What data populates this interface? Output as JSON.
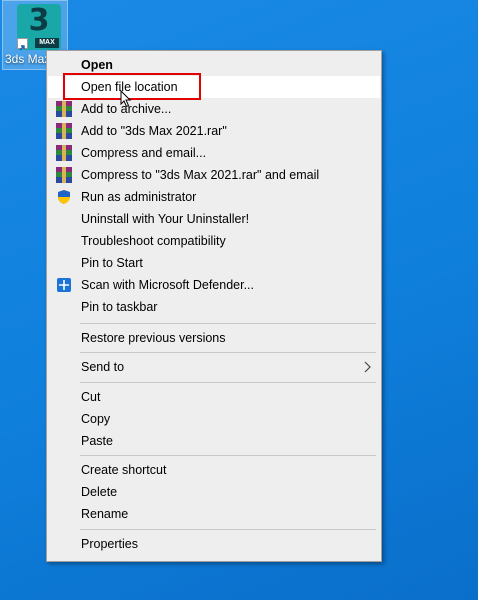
{
  "desktop": {
    "icon_label": "3ds Max",
    "logo_number": "3",
    "logo_text": "MAX"
  },
  "menu": {
    "items": [
      {
        "label": "Open"
      },
      {
        "label": "Open file location"
      },
      {
        "label": "Add to archive..."
      },
      {
        "label": "Add to \"3ds Max 2021.rar\""
      },
      {
        "label": "Compress and email..."
      },
      {
        "label": "Compress to \"3ds Max 2021.rar\" and email"
      },
      {
        "label": "Run as administrator"
      },
      {
        "label": "Uninstall with Your Uninstaller!"
      },
      {
        "label": "Troubleshoot compatibility"
      },
      {
        "label": "Pin to Start"
      },
      {
        "label": "Scan with Microsoft Defender..."
      },
      {
        "label": "Pin to taskbar"
      },
      {
        "label": "Restore previous versions"
      },
      {
        "label": "Send to"
      },
      {
        "label": "Cut"
      },
      {
        "label": "Copy"
      },
      {
        "label": "Paste"
      },
      {
        "label": "Create shortcut"
      },
      {
        "label": "Delete"
      },
      {
        "label": "Rename"
      },
      {
        "label": "Properties"
      }
    ],
    "submenu_icon": "chevron-right-icon"
  },
  "colors": {
    "highlight_box": "#e00000",
    "desktop": "#0f7fdc"
  }
}
